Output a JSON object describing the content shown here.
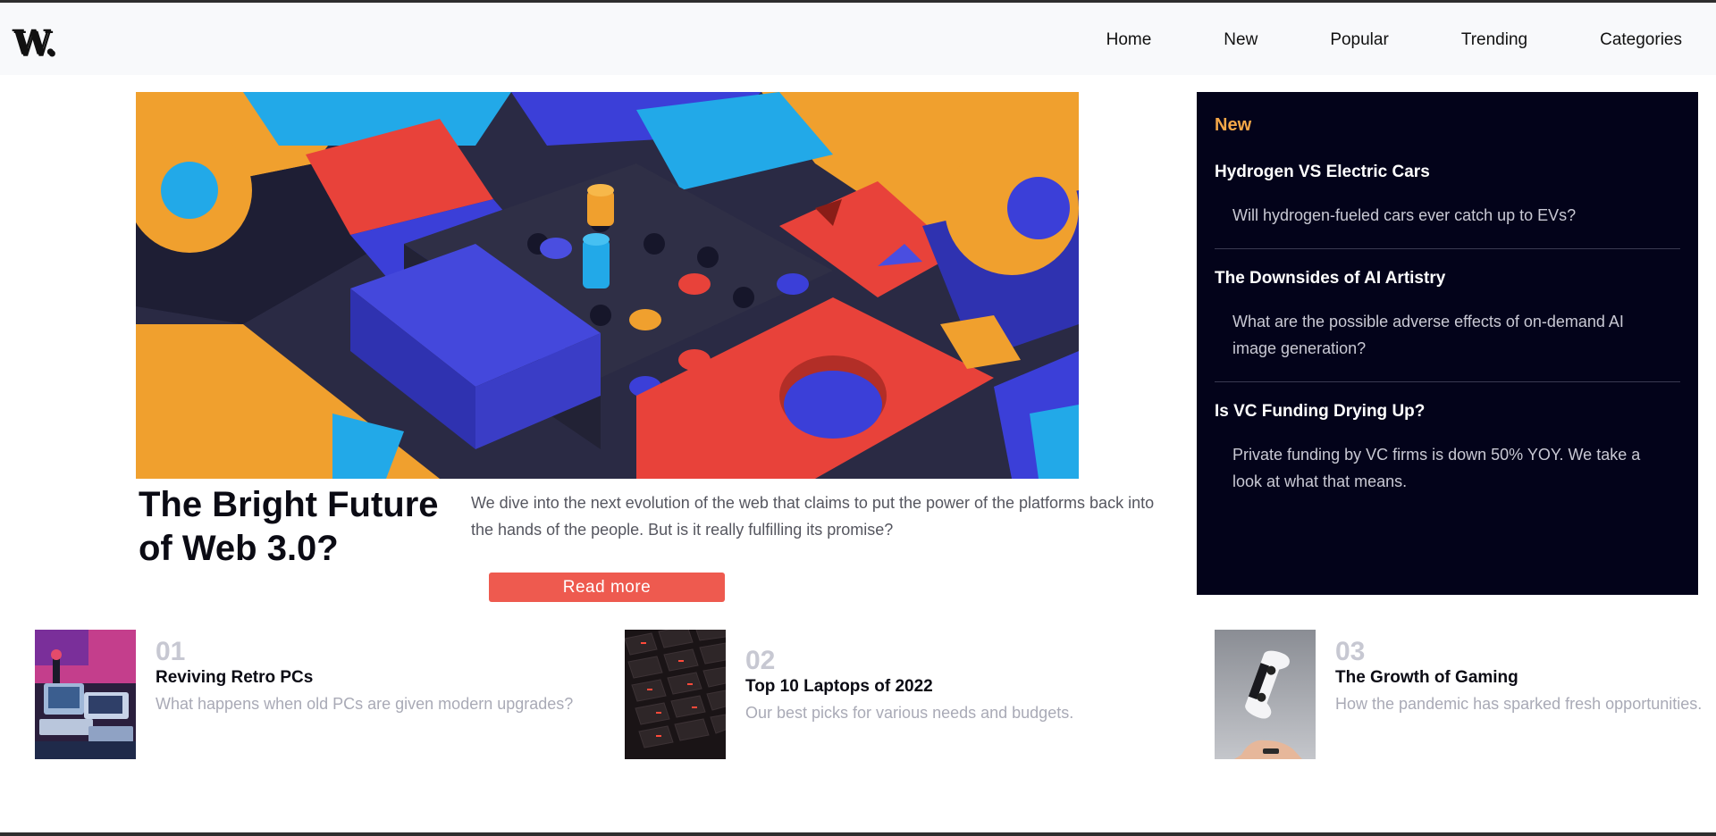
{
  "brand": {
    "logo": "W."
  },
  "nav": {
    "items": [
      "Home",
      "New",
      "Popular",
      "Trending",
      "Categories"
    ]
  },
  "hero": {
    "title": "The Bright Future of Web 3.0?",
    "description": "We dive into the next evolution of the web that claims to put the power of the platforms back into the hands of the people. But is it really fulfilling its promise?",
    "button_label": "Read more"
  },
  "sidebar": {
    "heading": "New",
    "items": [
      {
        "title": "Hydrogen VS Electric Cars",
        "description": "Will hydrogen-fueled cars ever catch up to EVs?"
      },
      {
        "title": "The Downsides of AI Artistry",
        "description": "What are the possible adverse effects of on-demand AI image generation?"
      },
      {
        "title": "Is VC Funding Drying Up?",
        "description": "Private funding by VC firms is down 50% YOY. We take a look at what that means."
      }
    ]
  },
  "cards": [
    {
      "number": "01",
      "title": "Reviving Retro PCs",
      "description": "What happens when old PCs are given modern upgrades?"
    },
    {
      "number": "02",
      "title": "Top 10 Laptops of 2022",
      "description": "Our best picks for various needs and budgets."
    },
    {
      "number": "03",
      "title": "The Growth of Gaming",
      "description": "How the pandemic has sparked fresh opportunities."
    }
  ],
  "colors": {
    "accent": "#ee5a4f",
    "sidebar_bg": "#03031a",
    "sidebar_heading": "#f5a848",
    "muted_text": "#a9aab6"
  }
}
